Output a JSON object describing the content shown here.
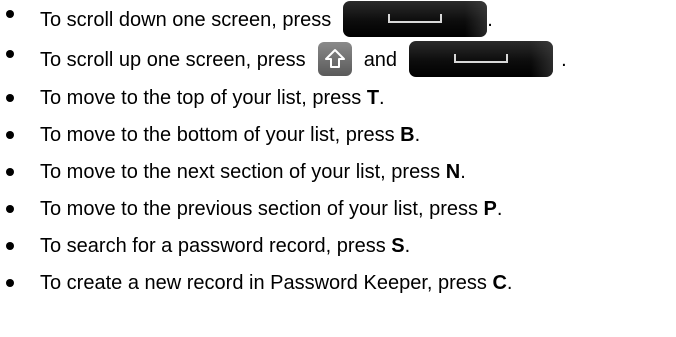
{
  "tips": [
    {
      "prefix": "To scroll down one screen, press",
      "suffix": "."
    },
    {
      "prefix": "To scroll up one screen, press",
      "and": "and",
      "suffix": "."
    },
    {
      "prefix": "To move to the top of your list, press ",
      "key": "T",
      "suffix": "."
    },
    {
      "prefix": "To move to the bottom of your list, press ",
      "key": "B",
      "suffix": "."
    },
    {
      "prefix": "To move to the next section of your list, press ",
      "key": "N",
      "suffix": "."
    },
    {
      "prefix": "To move to the previous section of your list, press ",
      "key": "P",
      "suffix": "."
    },
    {
      "prefix": "To search for a password record, press ",
      "key": "S",
      "suffix": "."
    },
    {
      "prefix": "To create a new record in Password Keeper, press ",
      "key": "C",
      "suffix": "."
    }
  ],
  "icons": {
    "space_key": "space-key-icon",
    "shift_key": "shift-key-icon"
  },
  "colors": {
    "text": "#000000",
    "space_key": "#111111",
    "shift_key": "#707070"
  }
}
